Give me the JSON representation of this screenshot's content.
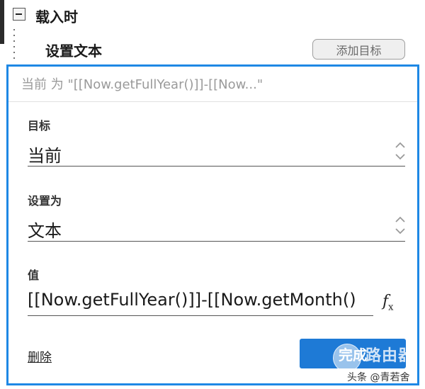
{
  "event": {
    "title": "载入时"
  },
  "action": {
    "title": "设置文本",
    "add_target_label": "添加目标"
  },
  "panel": {
    "summary": "当前 为 \"[[Now.getFullYear()]]-[[Now...\"",
    "target": {
      "label": "目标",
      "value": "当前"
    },
    "set_as": {
      "label": "设置为",
      "value": "文本"
    },
    "value": {
      "label": "值",
      "value": "[[Now.getFullYear()]]-[[Now.getMonth()"
    },
    "fx_icon": "fx-icon",
    "delete_label": "删除",
    "done_label": "完成"
  },
  "watermark": {
    "brand": "路由器",
    "credit": "头条 @青若舍"
  },
  "colors": {
    "accent": "#1e88e5",
    "done_button": "#1e7ad6"
  }
}
